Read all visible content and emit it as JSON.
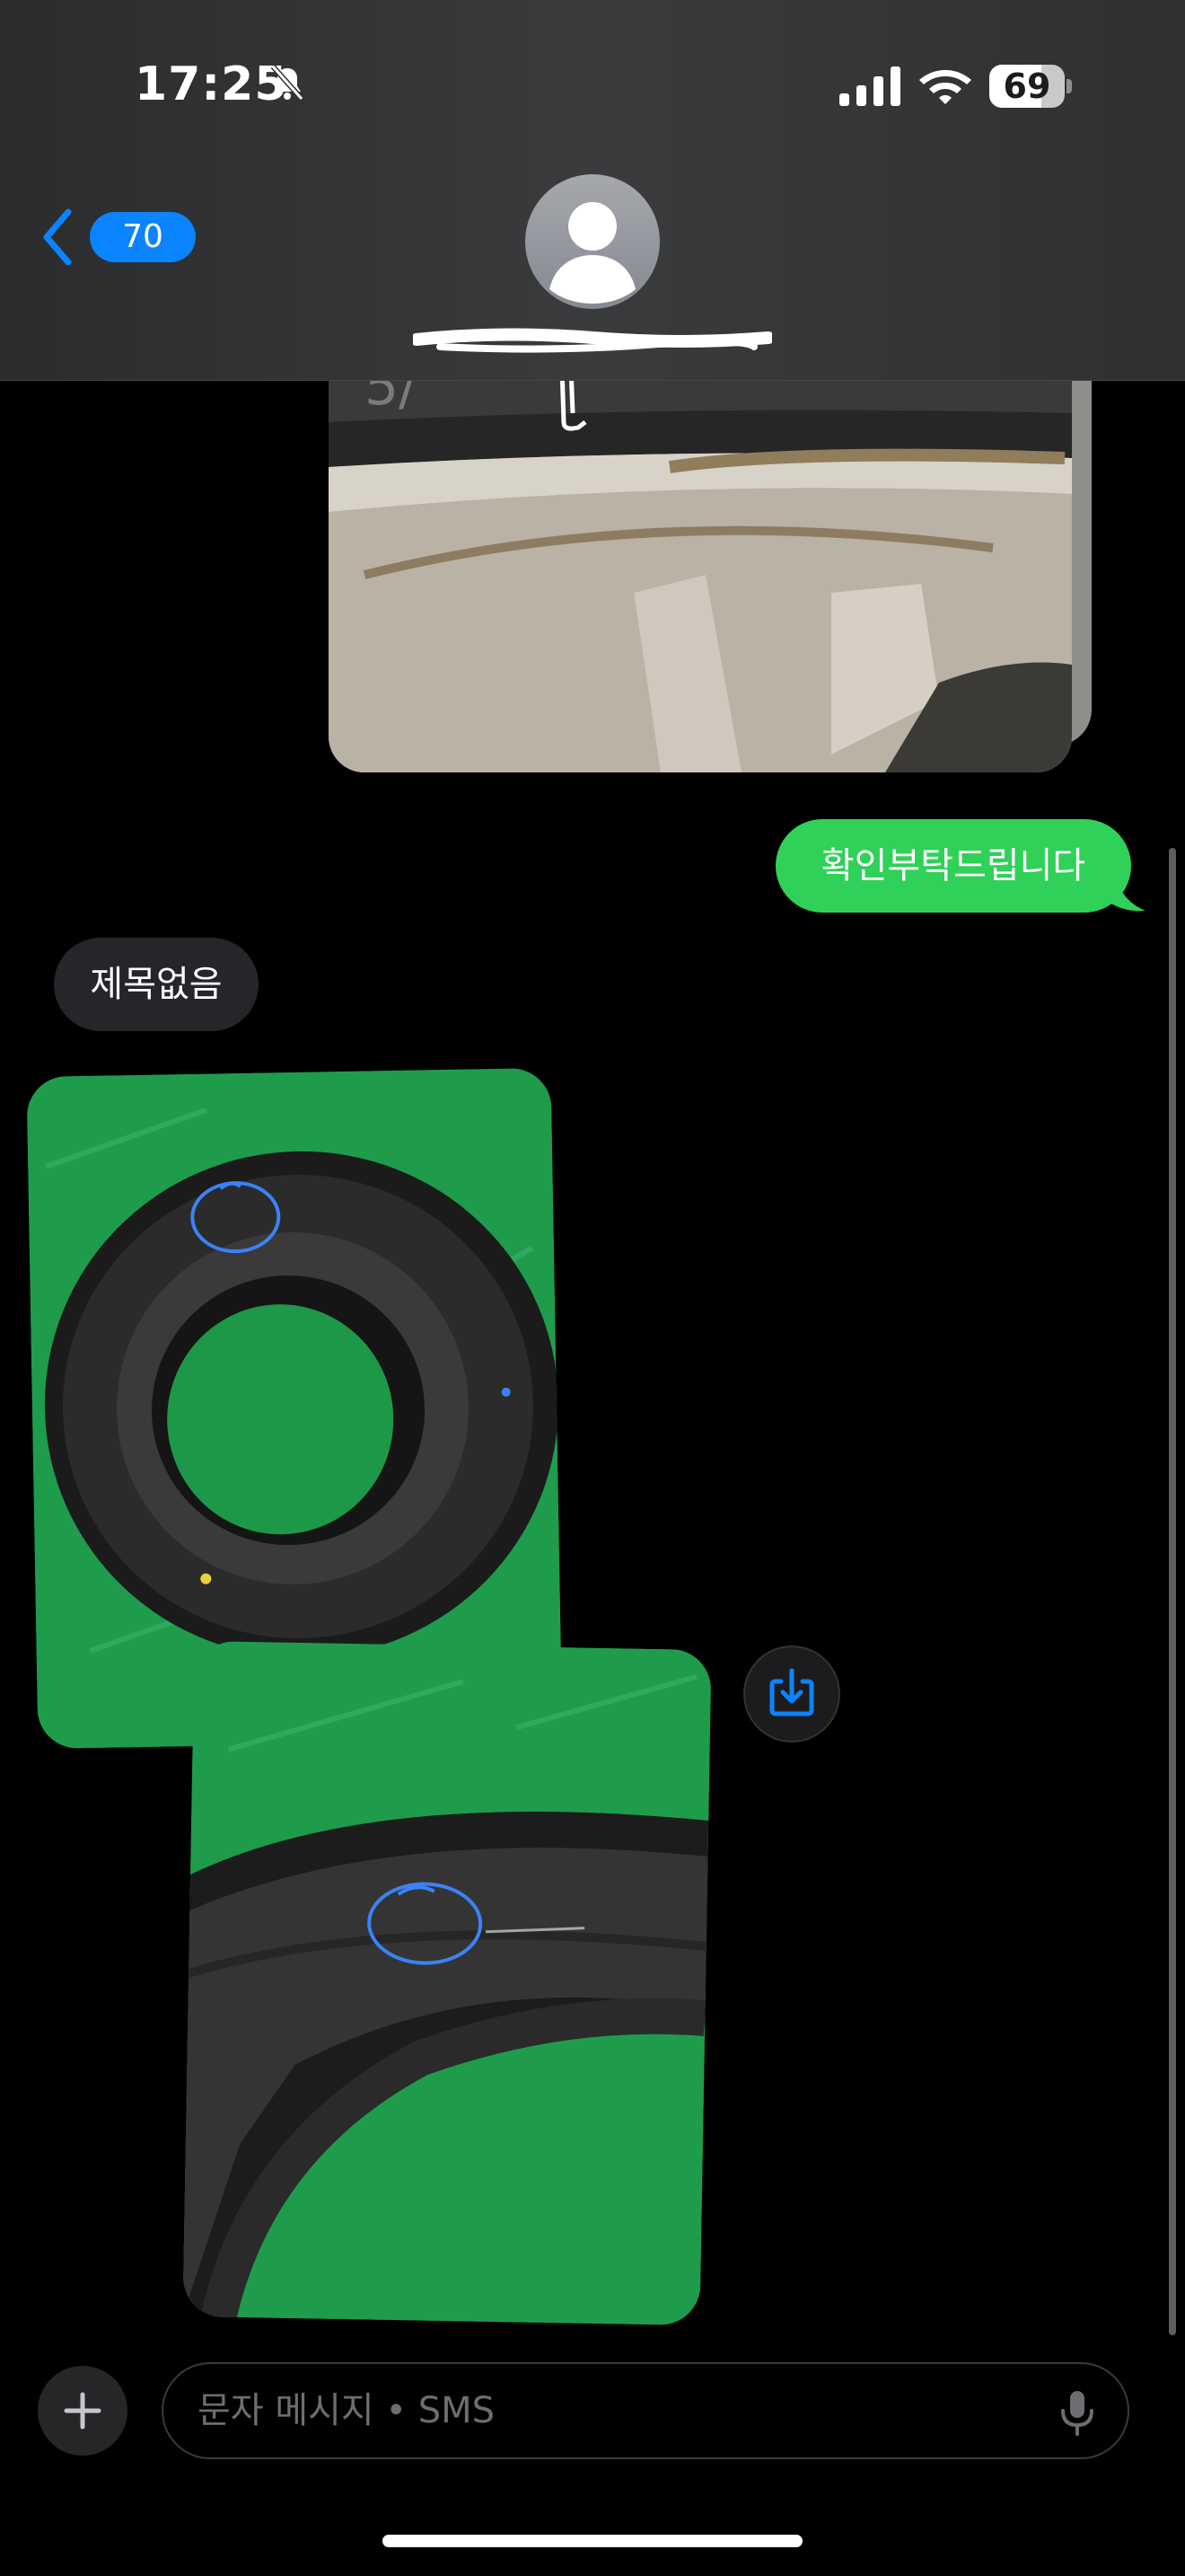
{
  "status_bar": {
    "time": "17:25",
    "battery_level": "69",
    "icons": [
      "bell-slash-icon",
      "cellular-signal-icon",
      "wifi-icon",
      "battery-icon"
    ]
  },
  "header": {
    "back_count": "70",
    "contact_avatar_icon": "person-silhouette-icon"
  },
  "messages": {
    "sent_text": "확인부탁드립니다",
    "received_subject": "제목없음"
  },
  "input": {
    "placeholder": "문자 메시지 • SMS",
    "icons": [
      "plus-icon",
      "mic-icon"
    ]
  },
  "colors": {
    "sent_bubble": "#30d158",
    "received_bubble": "#26252a",
    "accent": "#0a84ff"
  }
}
